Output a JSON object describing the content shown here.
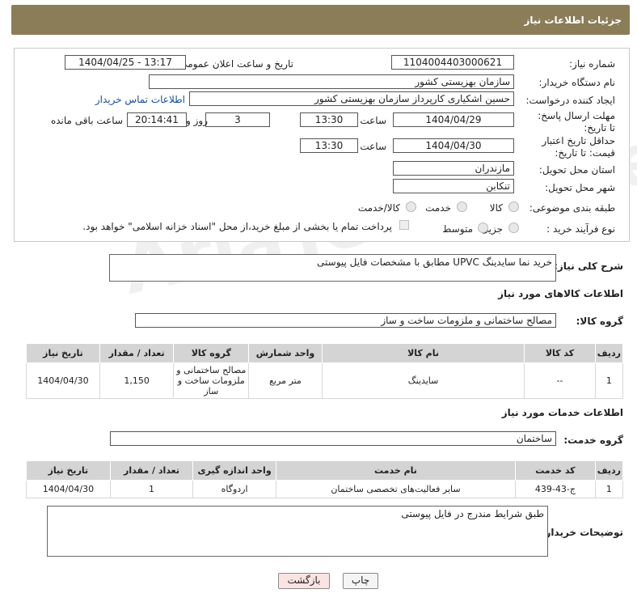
{
  "header": {
    "title": "جزئیات اطلاعات نیاز"
  },
  "form": {
    "need_number_label": "شماره نیاز:",
    "need_number": "1104004403000621",
    "announce_label": "تاریخ و ساعت اعلان عمومی:",
    "announce_value": "1404/04/25 - 13:17",
    "buyer_org_label": "نام دستگاه خریدار:",
    "buyer_org": "سازمان بهزیستی کشور",
    "creator_label": "ایجاد کننده درخواست:",
    "creator": "حسین اشکیاری کارپرداز سازمان بهزیستی کشور",
    "contact_link": "اطلاعات تماس خریدار",
    "deadline_label": "مهلت ارسال پاسخ: تا تاریخ:",
    "deadline_date": "1404/04/29",
    "time_label": "ساعت",
    "deadline_time": "13:30",
    "days_value": "3",
    "days_label": "روز و",
    "remaining_time": "20:14:41",
    "remaining_label": "ساعت باقی مانده",
    "validity_label": "حداقل تاریخ اعتبار قیمت: تا تاریخ:",
    "validity_date": "1404/04/30",
    "validity_time": "13:30",
    "province_label": "استان محل تحویل:",
    "province": "مازندران",
    "city_label": "شهر محل تحویل:",
    "city": "تنکابن",
    "category_label": "طبقه بندی موضوعی:",
    "category_options": [
      "کالا",
      "خدمت",
      "کالا/خدمت"
    ],
    "process_label": "نوع فرآیند خرید :",
    "process_options": [
      "جزیی",
      "متوسط"
    ],
    "payment_note": "پرداخت تمام یا بخشی از مبلغ خرید،از محل \"اسناد خزانه اسلامی\" خواهد بود."
  },
  "summary": {
    "label": "شرح کلی نیاز:",
    "text": "خرید نما سایدینگ UPVC مطابق با مشخصات فایل پیوستی"
  },
  "goods": {
    "title": "اطلاعات کالاهای مورد نیاز",
    "group_label": "گروه کالا:",
    "group_value": "مصالح ساختمانی و ملزومات ساخت و ساز",
    "columns": [
      "ردیف",
      "کد کالا",
      "نام کالا",
      "واحد شمارش",
      "گروه کالا",
      "تعداد / مقدار",
      "تاریخ نیاز"
    ],
    "rows": [
      [
        "1",
        "--",
        "سایدینگ",
        "متر مربع",
        "مصالح ساختمانی و ملزومات ساخت و ساز",
        "1,150",
        "1404/04/30"
      ]
    ]
  },
  "services": {
    "title": "اطلاعات خدمات مورد نیاز",
    "group_label": "گروه خدمت:",
    "group_value": "ساختمان",
    "columns": [
      "ردیف",
      "کد خدمت",
      "نام خدمت",
      "واحد اندازه گیری",
      "تعداد / مقدار",
      "تاریخ نیاز"
    ],
    "rows": [
      [
        "1",
        "ج-43-439",
        "سایر فعالیت‌های تخصصی ساختمان",
        "اردوگاه",
        "1",
        "1404/04/30"
      ]
    ]
  },
  "buyer_notes": {
    "label": "توضیحات خریدار:",
    "text": "طبق شرایط مندرج در فایل پیوستی"
  },
  "buttons": {
    "print": "چاپ",
    "back": "بازگشت"
  },
  "watermark": "AriaTender.net",
  "colors": {
    "header_bg": "#8b7d57",
    "link": "#1a4da0",
    "back_button": "#fbe3e3"
  }
}
